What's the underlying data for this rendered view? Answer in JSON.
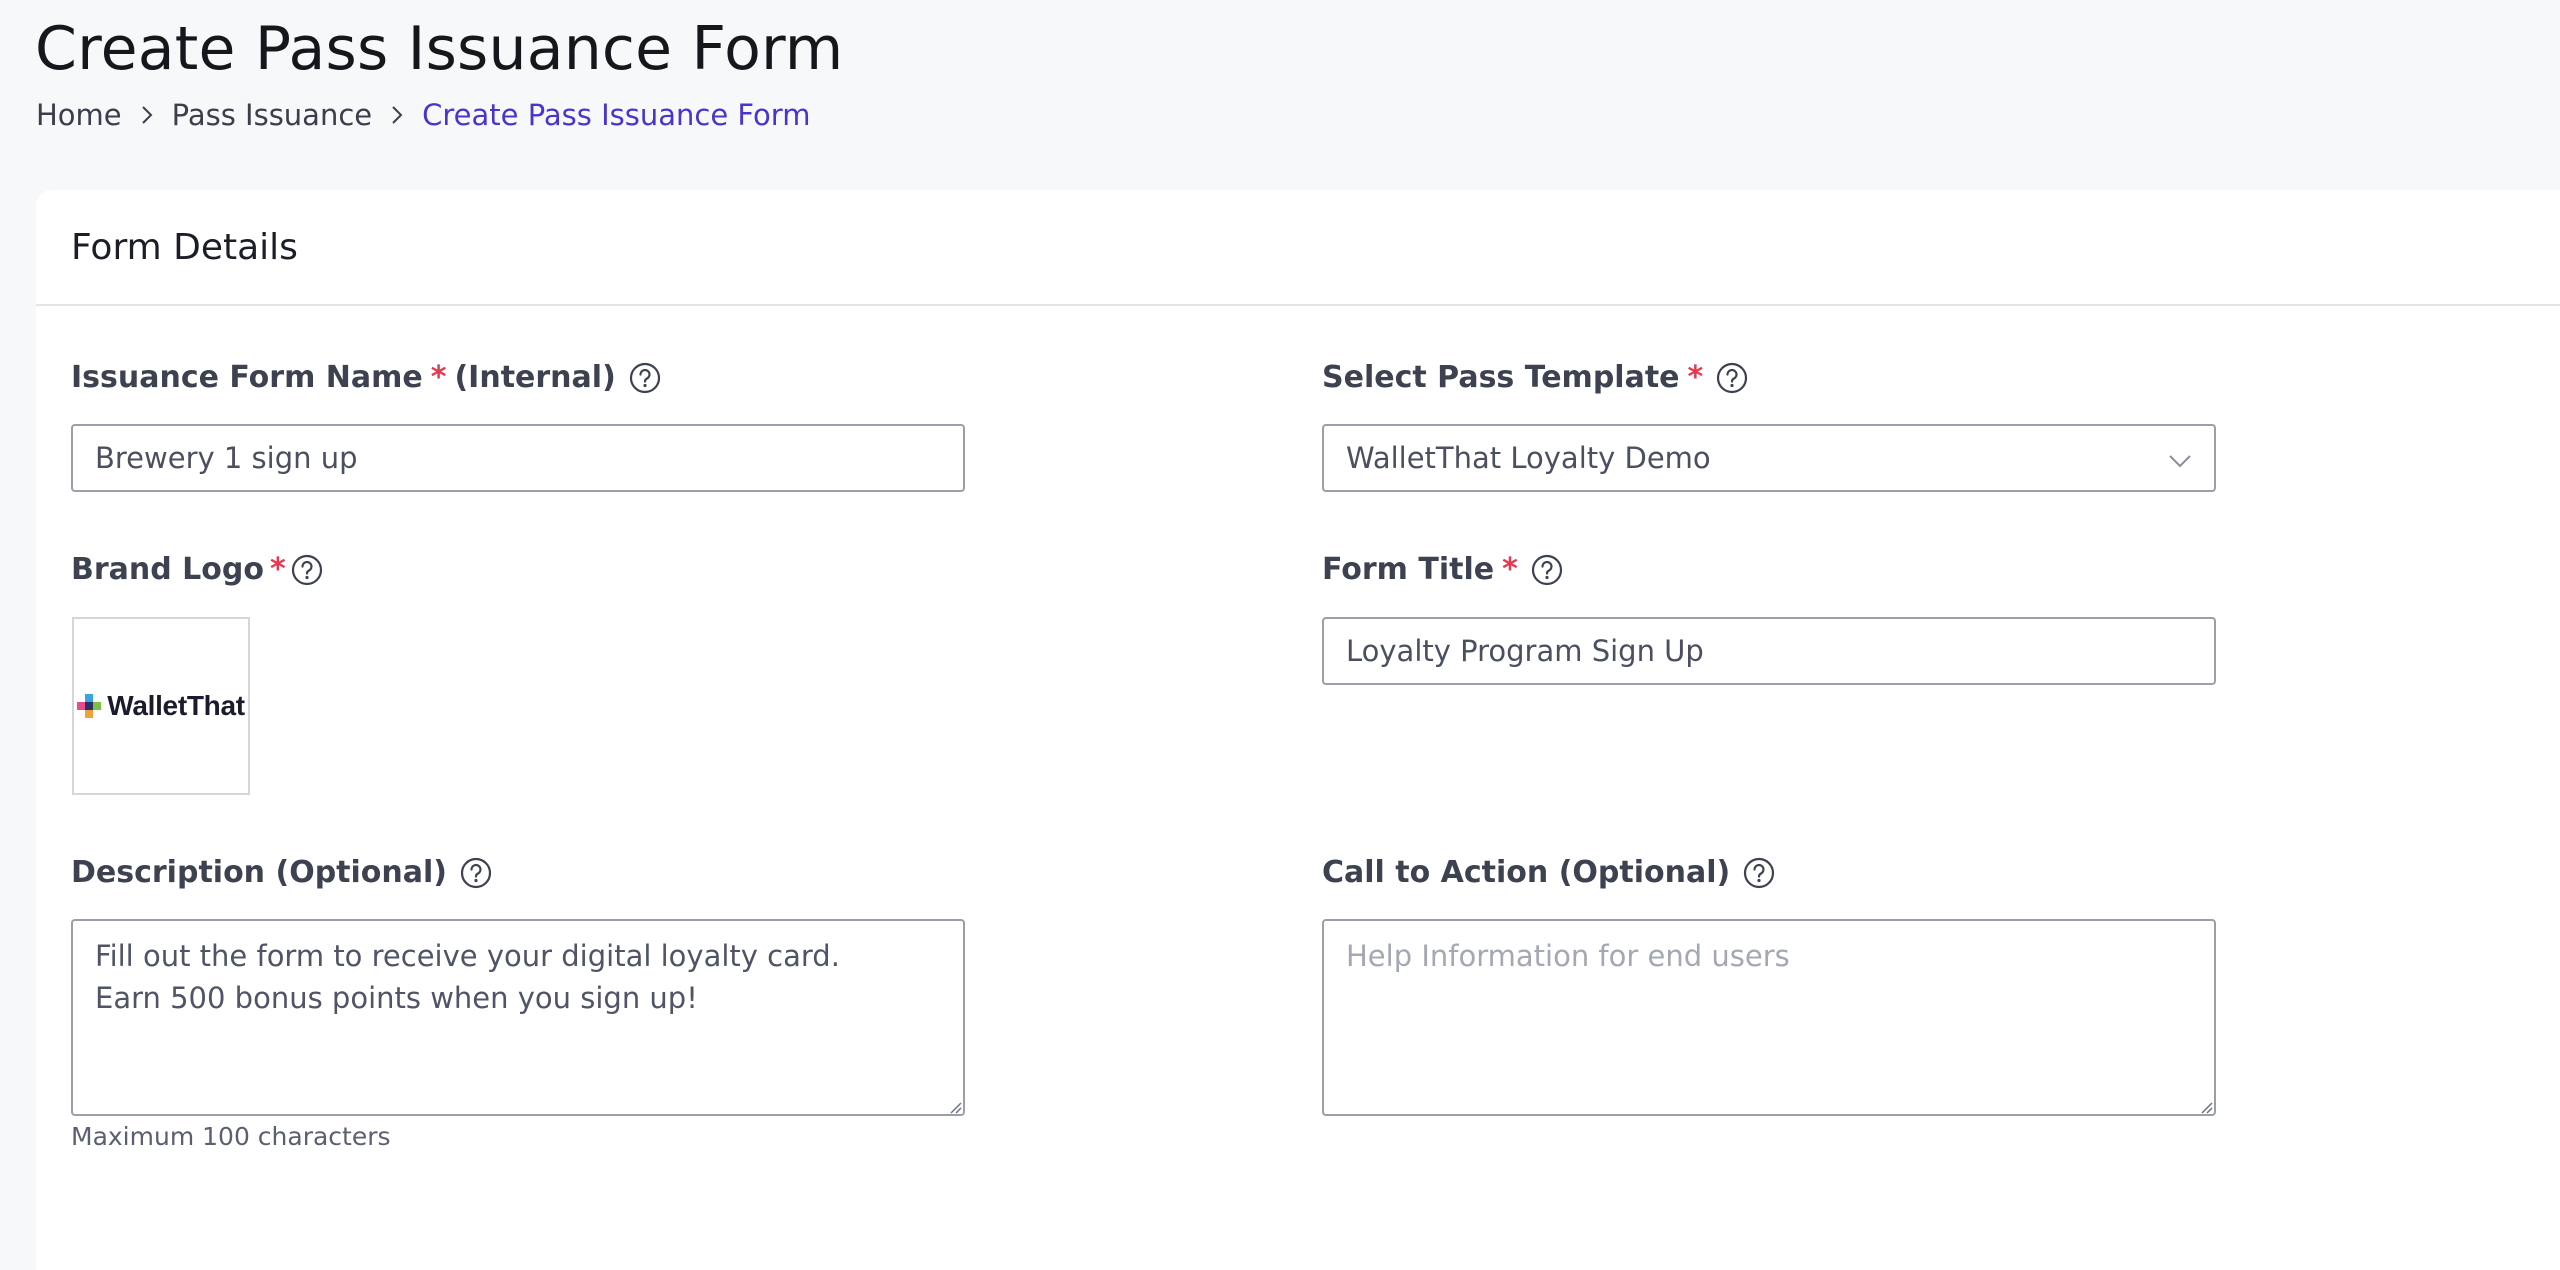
{
  "page": {
    "title": "Create Pass Issuance Form",
    "breadcrumb": [
      "Home",
      "Pass Issuance",
      "Create Pass Issuance Form"
    ]
  },
  "card": {
    "title": "Form Details"
  },
  "fields": {
    "form_name": {
      "label": "Issuance Form Name",
      "required_mark": "*",
      "suffix": "(Internal)",
      "value": "Brewery 1 sign up"
    },
    "pass_template": {
      "label": "Select Pass Template",
      "required_mark": "*",
      "value": "WalletThat Loyalty Demo"
    },
    "brand_logo": {
      "label": "Brand Logo",
      "required_mark": "*",
      "logo_text": "WalletThat"
    },
    "form_title": {
      "label": "Form Title",
      "required_mark": "*",
      "value": "Loyalty Program Sign Up"
    },
    "description": {
      "label": "Description (Optional)",
      "value": "Fill out the form to receive your digital loyalty card.\nEarn 500 bonus points when you sign up!",
      "hint": "Maximum 100 characters"
    },
    "call_to_action": {
      "label": "Call to Action (Optional)",
      "value": "",
      "placeholder": "Help Information for end users"
    }
  },
  "colors": {
    "accent": "#4a35c8",
    "required": "#e23a4e",
    "background": "#f7f8fa"
  },
  "icons": {
    "help": "help-circle-icon",
    "separator": "chevron-right-icon",
    "dropdown": "chevron-down-icon"
  }
}
